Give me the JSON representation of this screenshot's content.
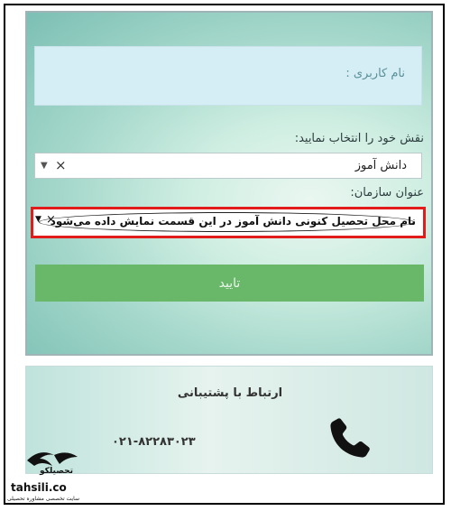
{
  "login_form": {
    "username_placeholder": "نام کاربری :",
    "role_label": "نقش خود را انتخاب نمایید:",
    "role_selected": "دانش آموز",
    "role_clear": "×",
    "role_arrow": "▼",
    "org_label": "عنوان سازمان:",
    "org_value": "نام محل تحصیل کنونی دانش آموز در این قسمت نمایش داده می‌شود",
    "org_clear": "×",
    "org_arrow": "▼",
    "submit_label": "تایید"
  },
  "support": {
    "title": "ارتباط با پشتیبانی",
    "phone": "۰۲۱-۸۲۲۸۳۰۲۳"
  },
  "watermark": {
    "brand": "تحصیلکو",
    "url": "tahsili.co",
    "tagline": "سایت تخصصی مشاوره تحصیلی"
  },
  "colors": {
    "highlight_border": "#e21b1b",
    "submit_bg": "#69b86a"
  }
}
